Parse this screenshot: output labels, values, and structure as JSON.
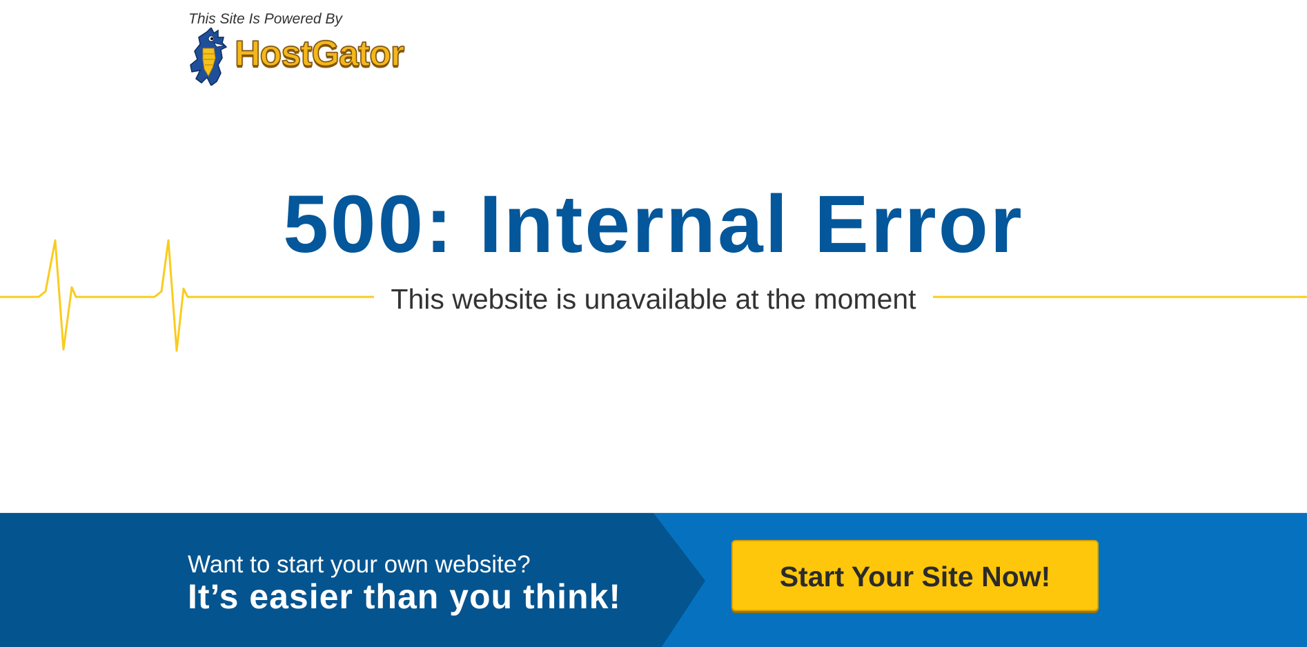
{
  "header": {
    "powered_by": "This Site Is Powered By",
    "logo_text": "HostGator"
  },
  "hero": {
    "title": "500: Internal Error",
    "subtitle": "This website is unavailable at the moment"
  },
  "banner": {
    "question": "Want to start your own website?",
    "tagline": "It’s easier than you think!",
    "cta_label": "Start Your Site Now!"
  },
  "colors": {
    "title_blue": "#04579a",
    "banner_dark": "#04548f",
    "banner_light": "#0672bf",
    "cta_yellow": "#fec70b",
    "pulse_yellow": "#f9cc1d"
  },
  "icons": {
    "logo_mascot": "gator-mascot-icon",
    "pulse_line": "heartbeat-line-icon"
  }
}
